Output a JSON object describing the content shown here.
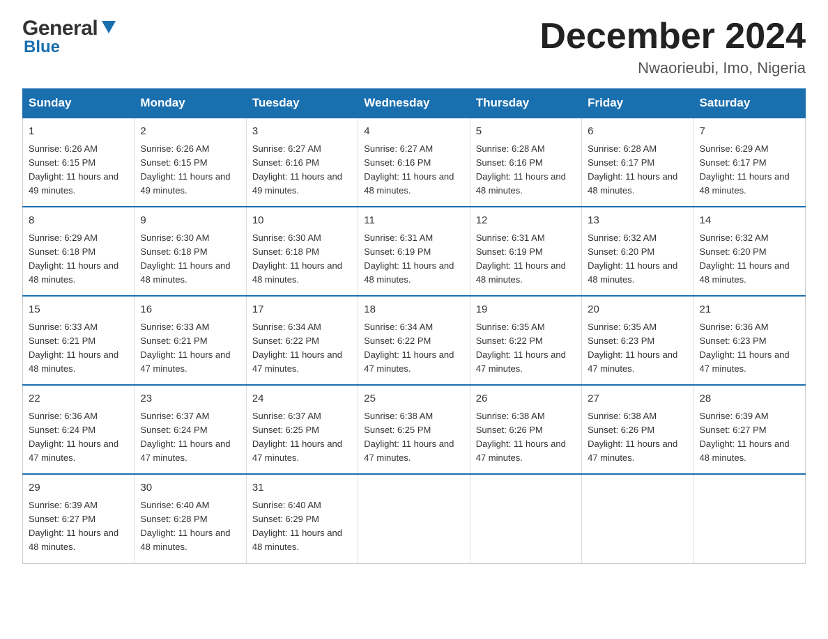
{
  "header": {
    "title": "December 2024",
    "location": "Nwaorieubi, Imo, Nigeria"
  },
  "logo": {
    "line1": "General",
    "line2": "Blue"
  },
  "days_header": [
    "Sunday",
    "Monday",
    "Tuesday",
    "Wednesday",
    "Thursday",
    "Friday",
    "Saturday"
  ],
  "weeks": [
    [
      {
        "day": "1",
        "sunrise": "6:26 AM",
        "sunset": "6:15 PM",
        "daylight": "11 hours and 49 minutes."
      },
      {
        "day": "2",
        "sunrise": "6:26 AM",
        "sunset": "6:15 PM",
        "daylight": "11 hours and 49 minutes."
      },
      {
        "day": "3",
        "sunrise": "6:27 AM",
        "sunset": "6:16 PM",
        "daylight": "11 hours and 49 minutes."
      },
      {
        "day": "4",
        "sunrise": "6:27 AM",
        "sunset": "6:16 PM",
        "daylight": "11 hours and 48 minutes."
      },
      {
        "day": "5",
        "sunrise": "6:28 AM",
        "sunset": "6:16 PM",
        "daylight": "11 hours and 48 minutes."
      },
      {
        "day": "6",
        "sunrise": "6:28 AM",
        "sunset": "6:17 PM",
        "daylight": "11 hours and 48 minutes."
      },
      {
        "day": "7",
        "sunrise": "6:29 AM",
        "sunset": "6:17 PM",
        "daylight": "11 hours and 48 minutes."
      }
    ],
    [
      {
        "day": "8",
        "sunrise": "6:29 AM",
        "sunset": "6:18 PM",
        "daylight": "11 hours and 48 minutes."
      },
      {
        "day": "9",
        "sunrise": "6:30 AM",
        "sunset": "6:18 PM",
        "daylight": "11 hours and 48 minutes."
      },
      {
        "day": "10",
        "sunrise": "6:30 AM",
        "sunset": "6:18 PM",
        "daylight": "11 hours and 48 minutes."
      },
      {
        "day": "11",
        "sunrise": "6:31 AM",
        "sunset": "6:19 PM",
        "daylight": "11 hours and 48 minutes."
      },
      {
        "day": "12",
        "sunrise": "6:31 AM",
        "sunset": "6:19 PM",
        "daylight": "11 hours and 48 minutes."
      },
      {
        "day": "13",
        "sunrise": "6:32 AM",
        "sunset": "6:20 PM",
        "daylight": "11 hours and 48 minutes."
      },
      {
        "day": "14",
        "sunrise": "6:32 AM",
        "sunset": "6:20 PM",
        "daylight": "11 hours and 48 minutes."
      }
    ],
    [
      {
        "day": "15",
        "sunrise": "6:33 AM",
        "sunset": "6:21 PM",
        "daylight": "11 hours and 48 minutes."
      },
      {
        "day": "16",
        "sunrise": "6:33 AM",
        "sunset": "6:21 PM",
        "daylight": "11 hours and 47 minutes."
      },
      {
        "day": "17",
        "sunrise": "6:34 AM",
        "sunset": "6:22 PM",
        "daylight": "11 hours and 47 minutes."
      },
      {
        "day": "18",
        "sunrise": "6:34 AM",
        "sunset": "6:22 PM",
        "daylight": "11 hours and 47 minutes."
      },
      {
        "day": "19",
        "sunrise": "6:35 AM",
        "sunset": "6:22 PM",
        "daylight": "11 hours and 47 minutes."
      },
      {
        "day": "20",
        "sunrise": "6:35 AM",
        "sunset": "6:23 PM",
        "daylight": "11 hours and 47 minutes."
      },
      {
        "day": "21",
        "sunrise": "6:36 AM",
        "sunset": "6:23 PM",
        "daylight": "11 hours and 47 minutes."
      }
    ],
    [
      {
        "day": "22",
        "sunrise": "6:36 AM",
        "sunset": "6:24 PM",
        "daylight": "11 hours and 47 minutes."
      },
      {
        "day": "23",
        "sunrise": "6:37 AM",
        "sunset": "6:24 PM",
        "daylight": "11 hours and 47 minutes."
      },
      {
        "day": "24",
        "sunrise": "6:37 AM",
        "sunset": "6:25 PM",
        "daylight": "11 hours and 47 minutes."
      },
      {
        "day": "25",
        "sunrise": "6:38 AM",
        "sunset": "6:25 PM",
        "daylight": "11 hours and 47 minutes."
      },
      {
        "day": "26",
        "sunrise": "6:38 AM",
        "sunset": "6:26 PM",
        "daylight": "11 hours and 47 minutes."
      },
      {
        "day": "27",
        "sunrise": "6:38 AM",
        "sunset": "6:26 PM",
        "daylight": "11 hours and 47 minutes."
      },
      {
        "day": "28",
        "sunrise": "6:39 AM",
        "sunset": "6:27 PM",
        "daylight": "11 hours and 48 minutes."
      }
    ],
    [
      {
        "day": "29",
        "sunrise": "6:39 AM",
        "sunset": "6:27 PM",
        "daylight": "11 hours and 48 minutes."
      },
      {
        "day": "30",
        "sunrise": "6:40 AM",
        "sunset": "6:28 PM",
        "daylight": "11 hours and 48 minutes."
      },
      {
        "day": "31",
        "sunrise": "6:40 AM",
        "sunset": "6:29 PM",
        "daylight": "11 hours and 48 minutes."
      },
      null,
      null,
      null,
      null
    ]
  ]
}
